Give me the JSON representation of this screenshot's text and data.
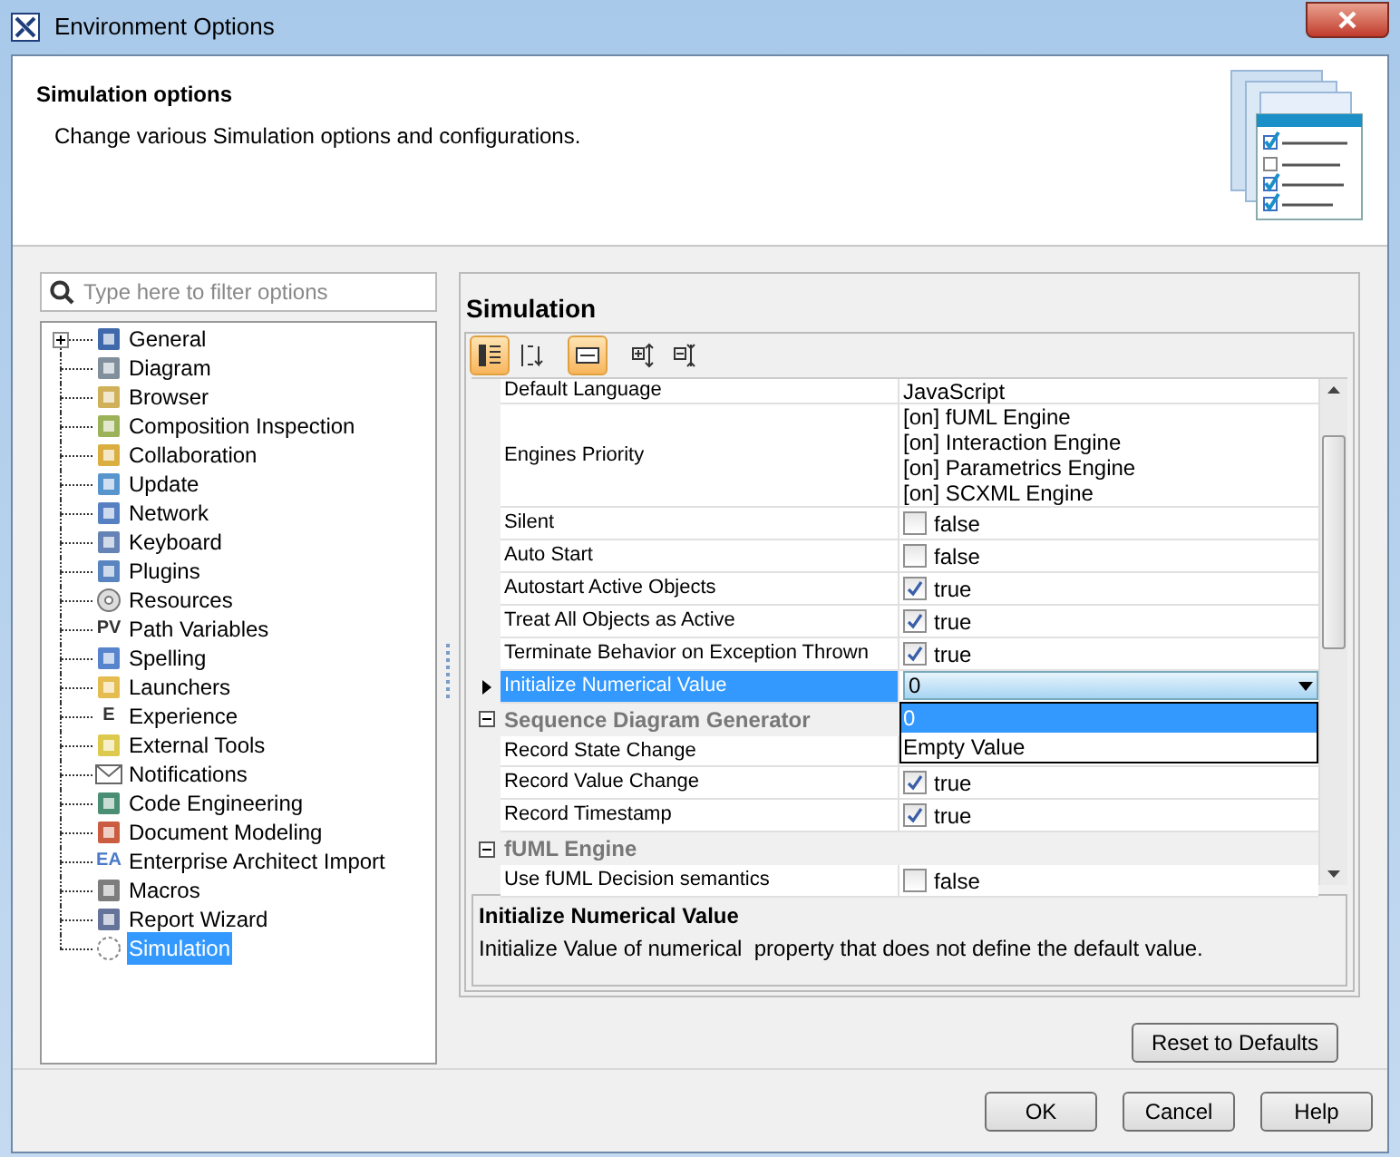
{
  "window": {
    "title": "Environment Options"
  },
  "header": {
    "title": "Simulation options",
    "subtitle": "Change various Simulation options and configurations."
  },
  "filter": {
    "placeholder": "Type here to filter options"
  },
  "tree": [
    {
      "label": "General",
      "selected": false,
      "expanded": false
    },
    {
      "label": "Diagram",
      "selected": false
    },
    {
      "label": "Browser",
      "selected": false
    },
    {
      "label": "Composition Inspection",
      "selected": false
    },
    {
      "label": "Collaboration",
      "selected": false
    },
    {
      "label": "Update",
      "selected": false
    },
    {
      "label": "Network",
      "selected": false
    },
    {
      "label": "Keyboard",
      "selected": false
    },
    {
      "label": "Plugins",
      "selected": false
    },
    {
      "label": "Resources",
      "selected": false
    },
    {
      "label": "Path Variables",
      "selected": false,
      "icon_text": "PV"
    },
    {
      "label": "Spelling",
      "selected": false
    },
    {
      "label": "Launchers",
      "selected": false
    },
    {
      "label": "Experience",
      "selected": false,
      "icon_text": "E"
    },
    {
      "label": "External Tools",
      "selected": false
    },
    {
      "label": "Notifications",
      "selected": false
    },
    {
      "label": "Code Engineering",
      "selected": false
    },
    {
      "label": "Document Modeling",
      "selected": false
    },
    {
      "label": "Enterprise Architect Import",
      "selected": false,
      "icon_text": "EA"
    },
    {
      "label": "Macros",
      "selected": false
    },
    {
      "label": "Report Wizard",
      "selected": false
    },
    {
      "label": "Simulation",
      "selected": true
    }
  ],
  "panel": {
    "title": "Simulation",
    "toolbar": [
      {
        "pressed": true
      },
      {
        "pressed": false
      },
      {
        "pressed": true
      },
      {
        "pressed": false
      },
      {
        "pressed": false
      }
    ],
    "rows": [
      {
        "kind": "text",
        "name": "Default Language",
        "value": "JavaScript",
        "selected": false
      },
      {
        "kind": "list",
        "name": "Engines Priority",
        "values": [
          "[on] fUML Engine",
          "[on] Interaction Engine",
          "[on] Parametrics Engine",
          "[on] SCXML Engine"
        ],
        "selected": false
      },
      {
        "kind": "checkbox",
        "name": "Silent",
        "checked": false,
        "value": "false",
        "selected": false
      },
      {
        "kind": "checkbox",
        "name": "Auto Start",
        "checked": false,
        "value": "false",
        "selected": false
      },
      {
        "kind": "checkbox",
        "name": "Autostart Active Objects",
        "checked": true,
        "value": "true",
        "selected": false
      },
      {
        "kind": "checkbox",
        "name": "Treat All Objects as Active",
        "checked": true,
        "value": "true",
        "selected": false
      },
      {
        "kind": "checkbox",
        "name": "Terminate Behavior on Exception Thrown",
        "checked": true,
        "value": "true",
        "selected": false
      },
      {
        "kind": "combo",
        "name": "Initialize Numerical Value",
        "value": "0",
        "selected": true,
        "options": [
          {
            "label": "0",
            "selected": true
          },
          {
            "label": "Empty Value",
            "selected": false
          }
        ]
      },
      {
        "kind": "group",
        "name": "Sequence Diagram Generator",
        "expanded": true
      },
      {
        "kind": "text",
        "name": "Record State Change",
        "selected": false
      },
      {
        "kind": "checkbox",
        "name": "Record Value Change",
        "checked": true,
        "value": "true",
        "selected": false
      },
      {
        "kind": "checkbox",
        "name": "Record Timestamp",
        "checked": true,
        "value": "true",
        "selected": false
      },
      {
        "kind": "group",
        "name": "fUML Engine",
        "expanded": true
      },
      {
        "kind": "checkbox",
        "name": "Use fUML Decision semantics",
        "checked": false,
        "value": "false",
        "selected": false
      }
    ],
    "description": {
      "title": "Initialize Numerical Value",
      "text": "Initialize Value of numerical  property that does not define the default value."
    },
    "reset_button": "Reset to Defaults"
  },
  "buttons": [
    "OK",
    "Cancel",
    "Help"
  ]
}
